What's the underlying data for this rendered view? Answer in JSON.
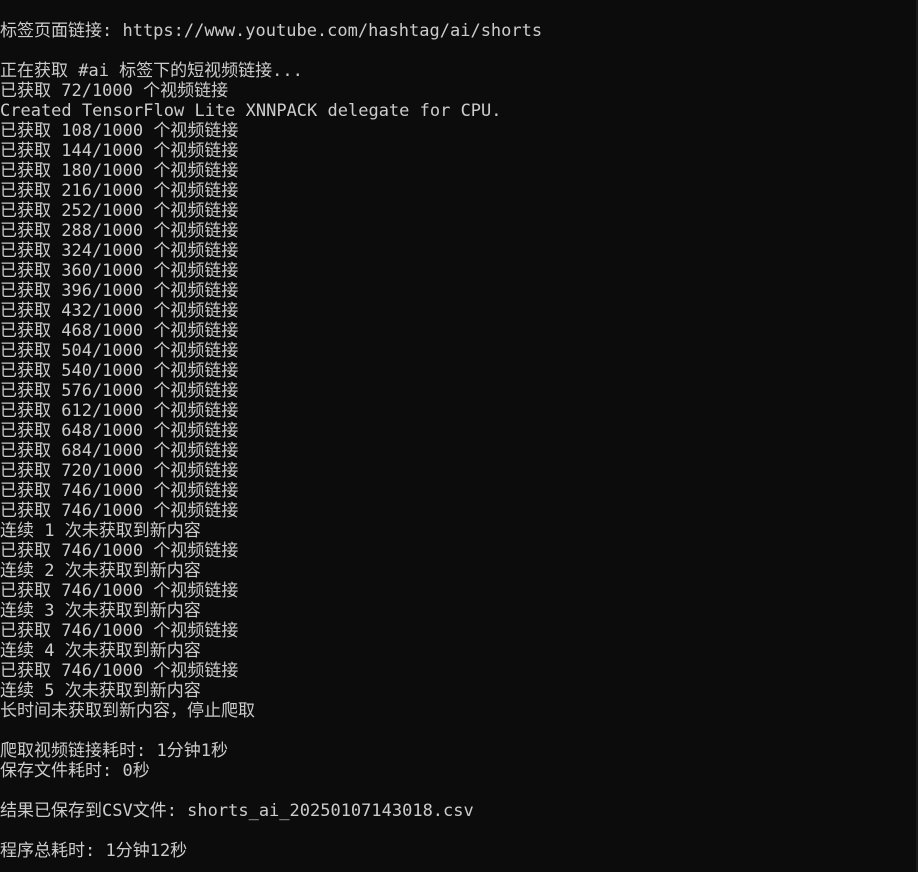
{
  "terminal": {
    "lines": [
      "标签页面链接: https://www.youtube.com/hashtag/ai/shorts",
      "",
      "正在获取 #ai 标签下的短视频链接...",
      "已获取 72/1000 个视频链接",
      "Created TensorFlow Lite XNNPACK delegate for CPU.",
      "已获取 108/1000 个视频链接",
      "已获取 144/1000 个视频链接",
      "已获取 180/1000 个视频链接",
      "已获取 216/1000 个视频链接",
      "已获取 252/1000 个视频链接",
      "已获取 288/1000 个视频链接",
      "已获取 324/1000 个视频链接",
      "已获取 360/1000 个视频链接",
      "已获取 396/1000 个视频链接",
      "已获取 432/1000 个视频链接",
      "已获取 468/1000 个视频链接",
      "已获取 504/1000 个视频链接",
      "已获取 540/1000 个视频链接",
      "已获取 576/1000 个视频链接",
      "已获取 612/1000 个视频链接",
      "已获取 648/1000 个视频链接",
      "已获取 684/1000 个视频链接",
      "已获取 720/1000 个视频链接",
      "已获取 746/1000 个视频链接",
      "已获取 746/1000 个视频链接",
      "连续 1 次未获取到新内容",
      "已获取 746/1000 个视频链接",
      "连续 2 次未获取到新内容",
      "已获取 746/1000 个视频链接",
      "连续 3 次未获取到新内容",
      "已获取 746/1000 个视频链接",
      "连续 4 次未获取到新内容",
      "已获取 746/1000 个视频链接",
      "连续 5 次未获取到新内容",
      "长时间未获取到新内容，停止爬取",
      "",
      "爬取视频链接耗时: 1分钟1秒",
      "保存文件耗时: 0秒",
      "",
      "结果已保存到CSV文件: shorts_ai_20250107143018.csv",
      "",
      "程序总耗时: 1分钟12秒"
    ]
  },
  "colors": {
    "background": "#0c0c0c",
    "foreground": "#cccccc"
  }
}
